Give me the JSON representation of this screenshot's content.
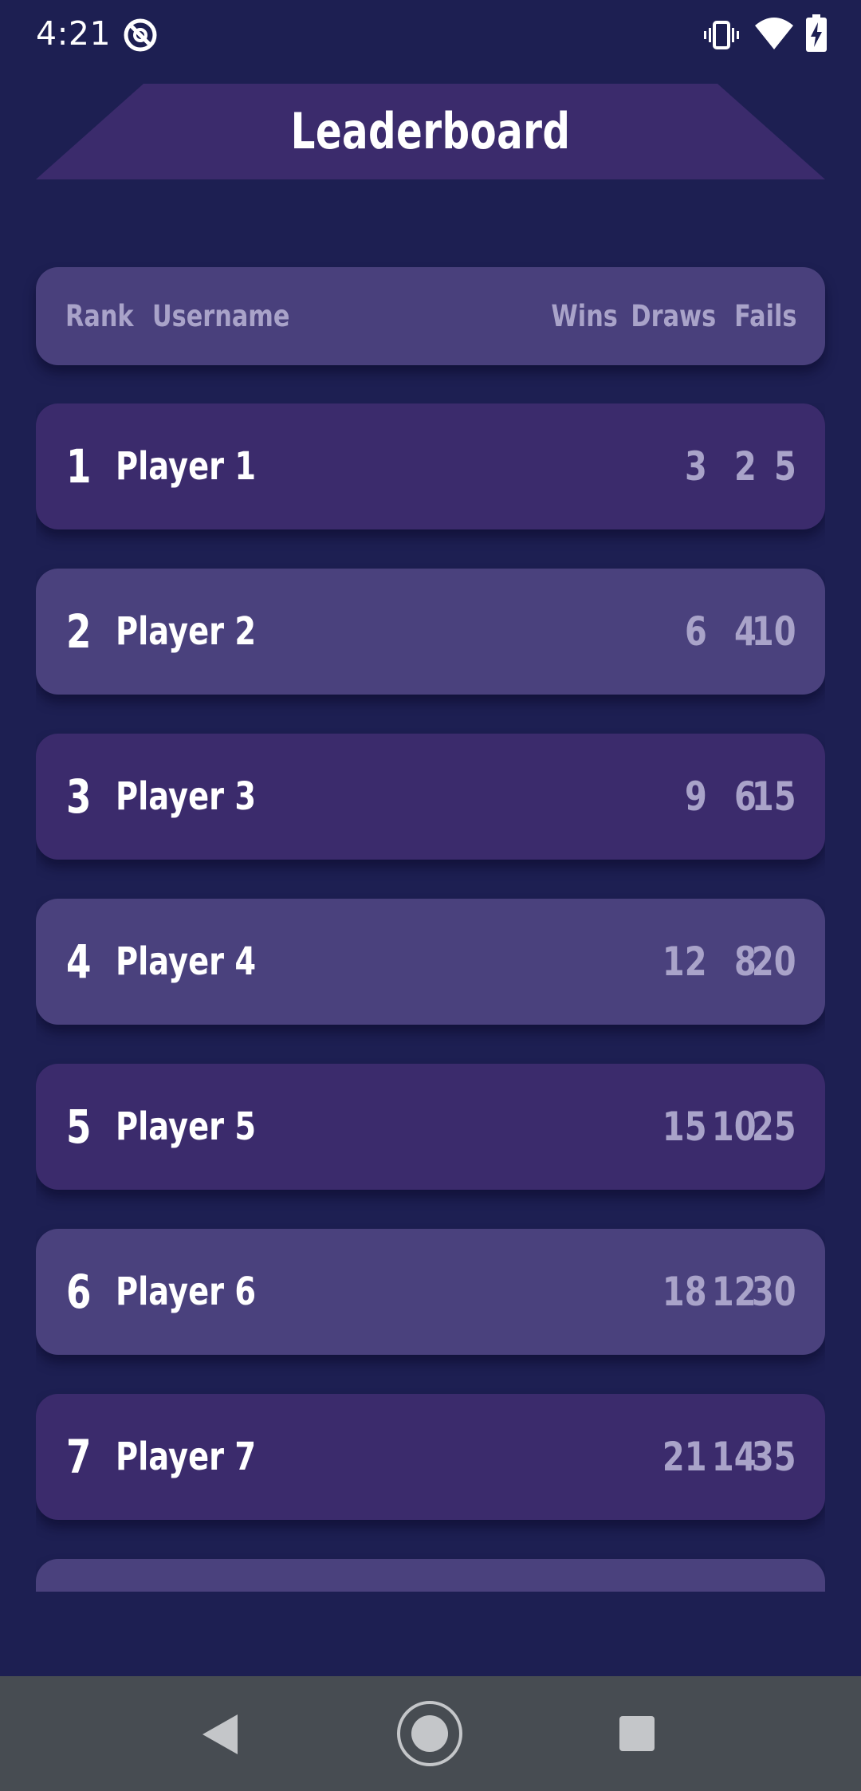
{
  "status_bar": {
    "time": "4:21",
    "icons": [
      "dnd-icon",
      "vibrate-icon",
      "wifi-icon",
      "battery-charging-icon"
    ]
  },
  "header": {
    "title": "Leaderboard"
  },
  "table": {
    "columns": {
      "rank": "Rank",
      "username": "Username",
      "wins": "Wins",
      "draws": "Draws",
      "fails": "Fails"
    },
    "rows": [
      {
        "rank": "1",
        "username": "Player 1",
        "wins": "3",
        "draws": "2",
        "fails": "5"
      },
      {
        "rank": "2",
        "username": "Player 2",
        "wins": "6",
        "draws": "4",
        "fails": "10"
      },
      {
        "rank": "3",
        "username": "Player 3",
        "wins": "9",
        "draws": "6",
        "fails": "15"
      },
      {
        "rank": "4",
        "username": "Player 4",
        "wins": "12",
        "draws": "8",
        "fails": "20"
      },
      {
        "rank": "5",
        "username": "Player 5",
        "wins": "15",
        "draws": "10",
        "fails": "25"
      },
      {
        "rank": "6",
        "username": "Player 6",
        "wins": "18",
        "draws": "12",
        "fails": "30"
      },
      {
        "rank": "7",
        "username": "Player 7",
        "wins": "21",
        "draws": "14",
        "fails": "35"
      }
    ]
  },
  "nav_bar": {
    "icons": [
      "back-icon",
      "home-icon",
      "recents-icon"
    ]
  },
  "colors": {
    "background": "#1d1f52",
    "header_banner": "#3b2b6c",
    "row_dark": "#3b2b6c",
    "row_light": "#4a417d",
    "muted_text": "#a9a3c9",
    "nav_bar": "#474c52"
  }
}
